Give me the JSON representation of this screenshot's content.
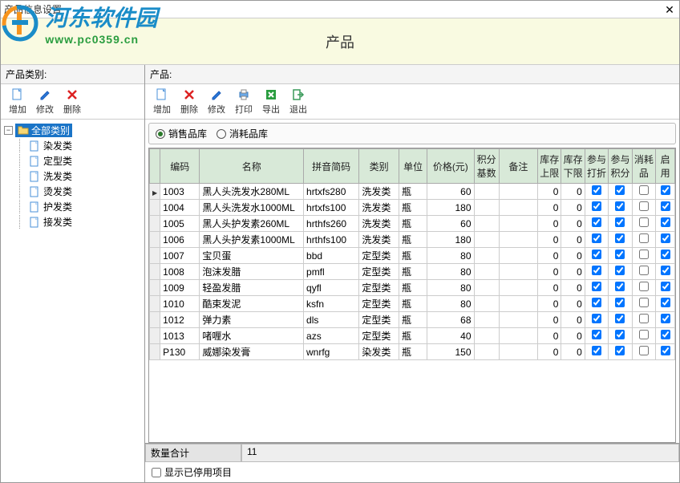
{
  "window": {
    "title": "产品信息设置"
  },
  "logo": {
    "text": "河东软件园",
    "url": "www.pc0359.cn"
  },
  "header": {
    "title": "产品"
  },
  "sidebar": {
    "label": "产品类别:",
    "toolbar": {
      "add": "增加",
      "edit": "修改",
      "delete": "删除"
    },
    "root": "全部类别",
    "categories": [
      "染发类",
      "定型类",
      "洗发类",
      "烫发类",
      "护发类",
      "接发类"
    ]
  },
  "main": {
    "label": "产品:",
    "toolbar": {
      "add": "增加",
      "delete": "删除",
      "edit": "修改",
      "print": "打印",
      "export": "导出",
      "exit": "退出"
    },
    "filter": {
      "opt_sales": "销售品库",
      "opt_consume": "消耗品库",
      "selected": "sales"
    },
    "columns": [
      "编码",
      "名称",
      "拼音简码",
      "类别",
      "单位",
      "价格(元)",
      "积分基数",
      "备注",
      "库存上限",
      "库存下限",
      "参与打折",
      "参与积分",
      "消耗品",
      "启用"
    ],
    "rows": [
      {
        "code": "1003",
        "name": "黑人头洗发水280ML",
        "py": "hrtxfs280",
        "cat": "洗发类",
        "unit": "瓶",
        "price": 60,
        "jifen": "",
        "remark": "",
        "up": 0,
        "down": 0,
        "discount": true,
        "point": true,
        "consume": false,
        "enable": true
      },
      {
        "code": "1004",
        "name": "黑人头洗发水1000ML",
        "py": "hrtxfs100",
        "cat": "洗发类",
        "unit": "瓶",
        "price": 180,
        "jifen": "",
        "remark": "",
        "up": 0,
        "down": 0,
        "discount": true,
        "point": true,
        "consume": false,
        "enable": true
      },
      {
        "code": "1005",
        "name": "黑人头护发素260ML",
        "py": "hrthfs260",
        "cat": "洗发类",
        "unit": "瓶",
        "price": 60,
        "jifen": "",
        "remark": "",
        "up": 0,
        "down": 0,
        "discount": true,
        "point": true,
        "consume": false,
        "enable": true
      },
      {
        "code": "1006",
        "name": "黑人头护发素1000ML",
        "py": "hrthfs100",
        "cat": "洗发类",
        "unit": "瓶",
        "price": 180,
        "jifen": "",
        "remark": "",
        "up": 0,
        "down": 0,
        "discount": true,
        "point": true,
        "consume": false,
        "enable": true
      },
      {
        "code": "1007",
        "name": "宝贝蛋",
        "py": "bbd",
        "cat": "定型类",
        "unit": "瓶",
        "price": 80,
        "jifen": "",
        "remark": "",
        "up": 0,
        "down": 0,
        "discount": true,
        "point": true,
        "consume": false,
        "enable": true
      },
      {
        "code": "1008",
        "name": "泡沫发腊",
        "py": "pmfl",
        "cat": "定型类",
        "unit": "瓶",
        "price": 80,
        "jifen": "",
        "remark": "",
        "up": 0,
        "down": 0,
        "discount": true,
        "point": true,
        "consume": false,
        "enable": true
      },
      {
        "code": "1009",
        "name": "轻盈发腊",
        "py": "qyfl",
        "cat": "定型类",
        "unit": "瓶",
        "price": 80,
        "jifen": "",
        "remark": "",
        "up": 0,
        "down": 0,
        "discount": true,
        "point": true,
        "consume": false,
        "enable": true
      },
      {
        "code": "1010",
        "name": "酷束发泥",
        "py": "ksfn",
        "cat": "定型类",
        "unit": "瓶",
        "price": 80,
        "jifen": "",
        "remark": "",
        "up": 0,
        "down": 0,
        "discount": true,
        "point": true,
        "consume": false,
        "enable": true
      },
      {
        "code": "1012",
        "name": "弹力素",
        "py": "dls",
        "cat": "定型类",
        "unit": "瓶",
        "price": 68,
        "jifen": "",
        "remark": "",
        "up": 0,
        "down": 0,
        "discount": true,
        "point": true,
        "consume": false,
        "enable": true
      },
      {
        "code": "1013",
        "name": "啫喱水",
        "py": "azs",
        "cat": "定型类",
        "unit": "瓶",
        "price": 40,
        "jifen": "",
        "remark": "",
        "up": 0,
        "down": 0,
        "discount": true,
        "point": true,
        "consume": false,
        "enable": true
      },
      {
        "code": "P130",
        "name": "威娜染发膏",
        "py": "wnrfg",
        "cat": "染发类",
        "unit": "瓶",
        "price": 150,
        "jifen": "",
        "remark": "",
        "up": 0,
        "down": 0,
        "discount": true,
        "point": true,
        "consume": false,
        "enable": true
      }
    ],
    "footer": {
      "count_label": "数量合计",
      "count_value": "11",
      "show_disabled": "显示已停用项目"
    }
  }
}
